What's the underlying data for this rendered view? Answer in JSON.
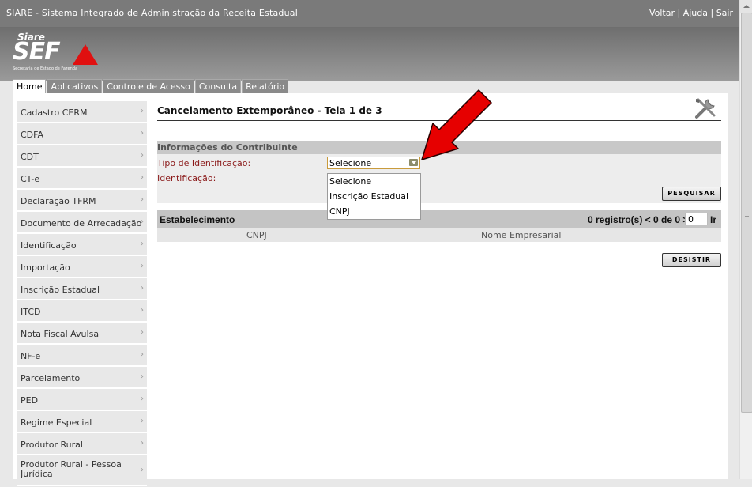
{
  "app": {
    "title": "SIARE - Sistema Integrado de Administração da Receita Estadual",
    "top_links": [
      "Voltar",
      "Ajuda",
      "Sair"
    ],
    "logo": {
      "small": "Siare",
      "big": "SEF",
      "subtitle": "Secretaria de Estado de Fazenda"
    }
  },
  "tabs": [
    {
      "label": "Home",
      "active": true
    },
    {
      "label": "Aplicativos",
      "active": false
    },
    {
      "label": "Controle de Acesso",
      "active": false
    },
    {
      "label": "Consulta",
      "active": false
    },
    {
      "label": "Relatório",
      "active": false
    }
  ],
  "sidebar": {
    "items": [
      {
        "label": "Cadastro CERM"
      },
      {
        "label": "CDFA"
      },
      {
        "label": "CDT"
      },
      {
        "label": "CT-e"
      },
      {
        "label": "Declaração TFRM"
      },
      {
        "label": "Documento de Arrecadação"
      },
      {
        "label": "Identificação"
      },
      {
        "label": "Importação"
      },
      {
        "label": "Inscrição Estadual"
      },
      {
        "label": "ITCD"
      },
      {
        "label": "Nota Fiscal Avulsa"
      },
      {
        "label": "NF-e"
      },
      {
        "label": "Parcelamento"
      },
      {
        "label": "PED"
      },
      {
        "label": "Regime Especial"
      },
      {
        "label": "Produtor Rural"
      },
      {
        "label": "Produtor Rural - Pessoa Jurídica"
      }
    ]
  },
  "main": {
    "title": "Cancelamento Extemporâneo - Tela 1 de 3",
    "section_title": "Informações do Contribuinte",
    "tipo_label": "Tipo de Identificação:",
    "ident_label": "Identificação:",
    "select_value": "Selecione",
    "select_options": [
      "Selecione",
      "Inscrição Estadual",
      "CNPJ"
    ],
    "search_button": "PESQUISAR",
    "estab": {
      "title": "Estabelecimento",
      "count": "0 registro(s) < 0 de 0 >",
      "page_input": "0",
      "go": "Ir",
      "columns": [
        "CNPJ",
        "Nome Empresarial"
      ]
    },
    "cancel_button": "DESISTIR"
  },
  "colors": {
    "annotation_arrow": "#e60000",
    "label_red": "#8b1a1a"
  }
}
